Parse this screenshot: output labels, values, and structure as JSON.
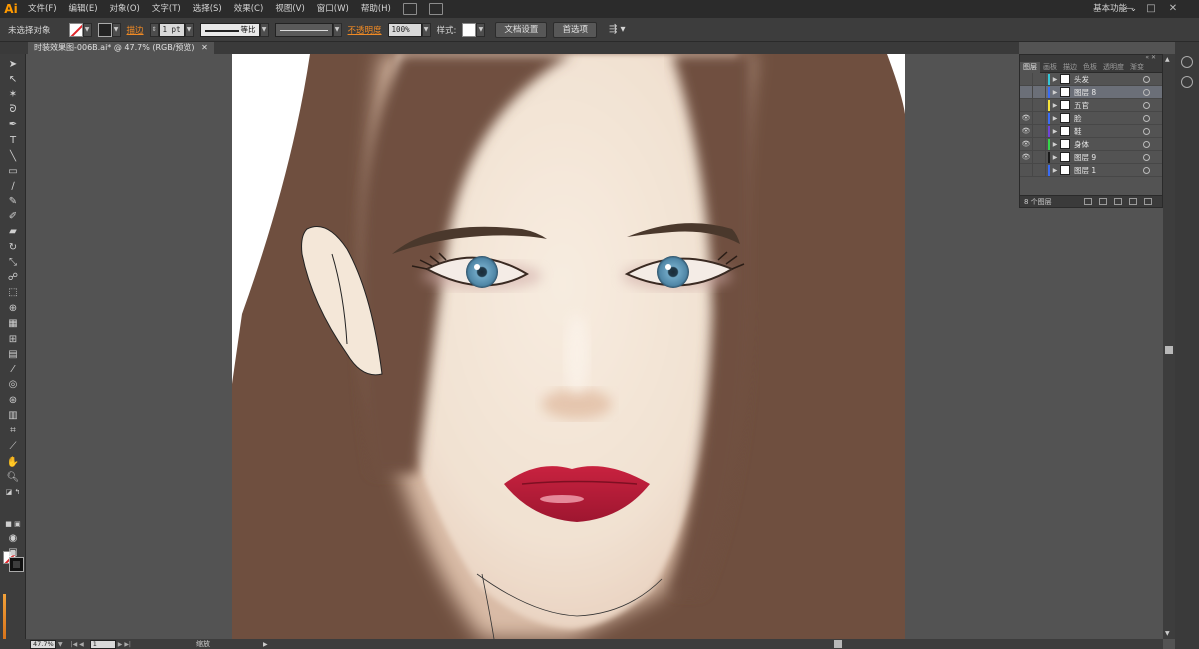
{
  "app": {
    "logo": "Ai"
  },
  "menu": {
    "items": [
      "文件(F)",
      "编辑(E)",
      "对象(O)",
      "文字(T)",
      "选择(S)",
      "效果(C)",
      "视图(V)",
      "窗口(W)",
      "帮助(H)"
    ],
    "workspace": "基本功能",
    "workspace_arrow": "⌄"
  },
  "window_controls": {
    "minimize": "—",
    "maximize": "□",
    "close": "✕"
  },
  "control_bar": {
    "selection": "未选择对象",
    "stroke_link": "描边",
    "stroke_weight": "1 pt",
    "stroke_profile": "等比",
    "opacity_link": "不透明度",
    "opacity_value": "100%",
    "style_label": "样式:",
    "doc_setup_button": "文档设置",
    "preferences_button": "首选项"
  },
  "document": {
    "tab_title": "时装效果图-006B.ai* @ 47.7% (RGB/预览)",
    "tab_close": "✕"
  },
  "status_bar": {
    "zoom": "47.7%",
    "page": "1",
    "tool_name": "缩放"
  },
  "layers_panel": {
    "tabs": [
      "图层",
      "画板",
      "描边",
      "色板",
      "透明度",
      "渐变"
    ],
    "active_tab": 0,
    "layers": [
      {
        "name": "头发",
        "visible": false,
        "color": "#35c6d6",
        "selected": false
      },
      {
        "name": "图层 8",
        "visible": false,
        "color": "#3a6cf4",
        "selected": true
      },
      {
        "name": "五官",
        "visible": false,
        "color": "#f4e23a",
        "selected": false
      },
      {
        "name": "脸",
        "visible": true,
        "color": "#3a6cf4",
        "selected": false
      },
      {
        "name": "鞋",
        "visible": true,
        "color": "#6e44d8",
        "selected": false
      },
      {
        "name": "身体",
        "visible": true,
        "color": "#35d64a",
        "selected": false
      },
      {
        "name": "图层 9",
        "visible": true,
        "color": "#1a1a1a",
        "selected": false
      },
      {
        "name": "图层 1",
        "visible": false,
        "color": "#3a6cf4",
        "selected": false
      }
    ],
    "footer_count": "8 个图层"
  },
  "colors": {
    "hair": "#6f4e3e",
    "skin": "#f3e3d3",
    "lips": "#c41f3c",
    "iris": "#5a8fae",
    "accent": "#f08a24"
  },
  "icons": {
    "eye": "👁",
    "expand": "▶",
    "tools": [
      "selection-tool-icon",
      "direct-selection-tool-icon",
      "magic-wand-icon",
      "lasso-icon",
      "pen-tool-icon",
      "type-tool-icon",
      "line-tool-icon",
      "rectangle-tool-icon",
      "paintbrush-icon",
      "pencil-icon",
      "blob-brush-icon",
      "eraser-icon",
      "rotate-tool-icon",
      "scale-tool-icon",
      "warp-tool-icon",
      "free-transform-icon",
      "shape-builder-icon",
      "perspective-grid-icon",
      "mesh-tool-icon",
      "gradient-tool-icon",
      "eyedropper-icon",
      "blend-tool-icon",
      "symbol-sprayer-icon",
      "column-graph-icon",
      "artboard-tool-icon",
      "slice-tool-icon",
      "hand-tool-icon",
      "zoom-tool-icon"
    ]
  }
}
